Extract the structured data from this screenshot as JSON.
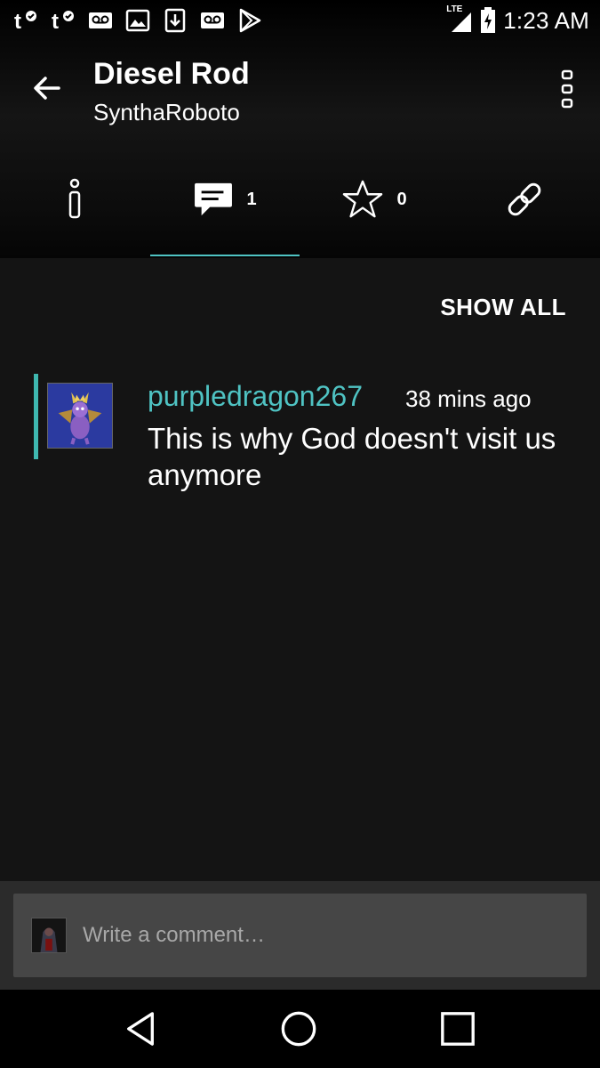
{
  "status_bar": {
    "left_icons": [
      "t-mobile-icon",
      "t-mobile-icon",
      "voicemail-icon",
      "image-icon",
      "download-icon",
      "voicemail-icon",
      "play-store-icon"
    ],
    "network": "LTE",
    "time": "1:23 AM"
  },
  "app_bar": {
    "title": "Diesel Rod",
    "subtitle": "SynthaRoboto"
  },
  "tabs": [
    {
      "name": "info",
      "icon": "info-icon",
      "count": ""
    },
    {
      "name": "comments",
      "icon": "comment-icon",
      "count": "1",
      "active": true
    },
    {
      "name": "favorites",
      "icon": "star-icon",
      "count": "0"
    },
    {
      "name": "link",
      "icon": "link-icon",
      "count": ""
    }
  ],
  "show_all_label": "SHOW ALL",
  "comments": [
    {
      "username": "purpledragon267",
      "time": "38 mins ago",
      "text": "This is why God doesn't visit us anymore"
    }
  ],
  "compose": {
    "placeholder": "Write a comment…"
  },
  "colors": {
    "accent": "#4fc3c3",
    "background": "#141414",
    "compose_bar": "#2b2b2b",
    "compose_field": "#464646"
  }
}
